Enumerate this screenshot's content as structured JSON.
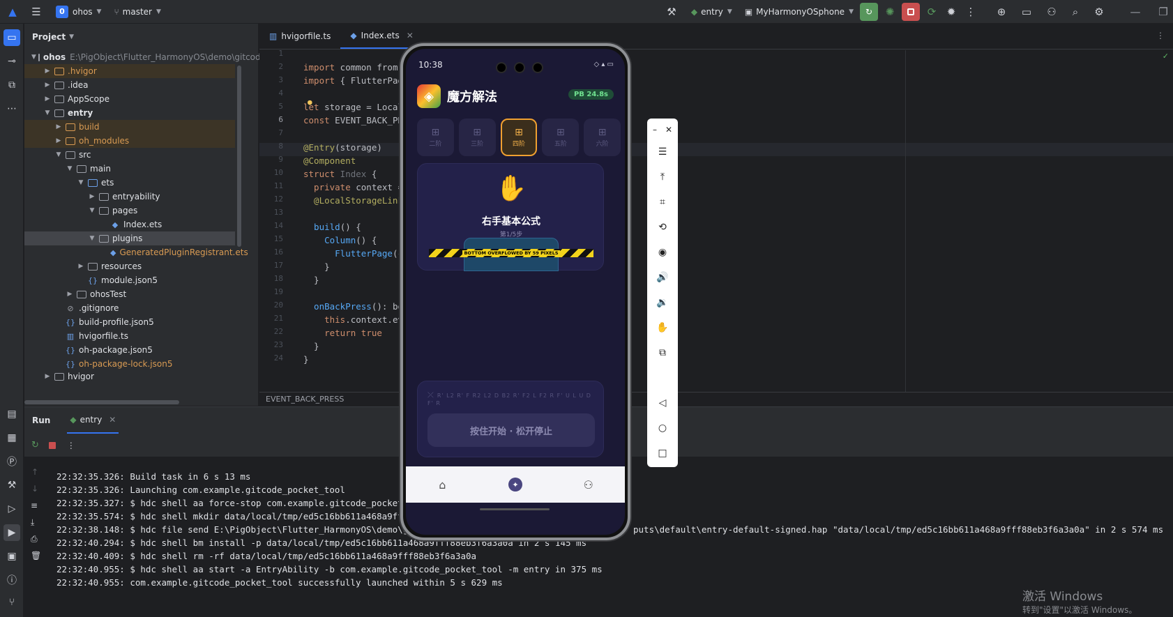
{
  "titlebar": {
    "project_badge": "0",
    "project_name": "ohos",
    "branch": "master",
    "run_config": "entry",
    "device": "MyHarmonyOSphone"
  },
  "project_panel": {
    "title": "Project",
    "root_name": "ohos",
    "root_path": "E:\\PigObject\\Flutter_HarmonyOS\\demo\\gitcode_",
    "items": [
      {
        "label": ".hvigor"
      },
      {
        "label": ".idea"
      },
      {
        "label": "AppScope"
      },
      {
        "label": "entry"
      },
      {
        "label": "build"
      },
      {
        "label": "oh_modules"
      },
      {
        "label": "src"
      },
      {
        "label": "main"
      },
      {
        "label": "ets"
      },
      {
        "label": "entryability"
      },
      {
        "label": "pages"
      },
      {
        "label": "Index.ets"
      },
      {
        "label": "plugins"
      },
      {
        "label": "GeneratedPluginRegistrant.ets"
      },
      {
        "label": "resources"
      },
      {
        "label": "module.json5"
      },
      {
        "label": "ohosTest"
      },
      {
        "label": ".gitignore"
      },
      {
        "label": "build-profile.json5"
      },
      {
        "label": "hvigorfile.ts"
      },
      {
        "label": "oh-package.json5"
      },
      {
        "label": "oh-package-lock.json5"
      },
      {
        "label": "hvigor"
      }
    ]
  },
  "editor": {
    "tabs": [
      {
        "label": "hvigorfile.ts"
      },
      {
        "label": "Index.ets"
      }
    ],
    "line_numbers": [
      "1",
      "2",
      "3",
      "4",
      "5",
      "6",
      "7",
      "8",
      "9",
      "10",
      "11",
      "12",
      "13",
      "14",
      "15",
      "16",
      "17",
      "18",
      "19",
      "20",
      "21",
      "22",
      "23",
      "24"
    ],
    "breadcrumb": "EVENT_BACK_PRESS",
    "code": {
      "l2a": "import",
      "l2b": " common from",
      "l3a": "import",
      "l3b": " { FlutterPag",
      "l5a": "let",
      "l5b": " storage = Local",
      "l6a": "const",
      "l6b": " EVENT_BACK_PR",
      "l8a": "@Entry",
      "l8b": "(storage)",
      "l9a": "@Component",
      "l10a": "struct",
      "l10b": " Index",
      "l10c": " {",
      "l11a": "  private",
      "l11b": " context =",
      "l12a": "  @LocalStorageLink",
      "l14a": "  build",
      "l14b": "() {",
      "l15a": "    Column",
      "l15b": "() {",
      "l16a": "      FlutterPage",
      "l16b": "({",
      "l17a": "    }",
      "l18a": "  }",
      "l20a": "  onBackPress",
      "l20b": "(): bo",
      "l21a": "    this",
      "l21b": ".context.ev",
      "l22a": "    return",
      "l22b": " true",
      "l23a": "  }",
      "l24a": "}"
    }
  },
  "run_panel": {
    "title": "Run",
    "tab": "entry",
    "log": [
      "22:32:35.326: Build task in 6 s 13 ms",
      "22:32:35.326: Launching com.example.gitcode_pocket_tool",
      "22:32:35.327: $ hdc shell aa force-stop com.example.gitcode_pocket_t",
      "22:32:35.574: $ hdc shell mkdir data/local/tmp/ed5c16bb611a468a9fff8",
      "22:32:38.148: $ hdc file send E:\\PigObject\\Flutter_HarmonyOS\\demo\\gitc",
      "22:32:40.294: $ hdc shell bm install -p data/local/tmp/ed5c16bb611a468a9fff88eb3f6a3a0a in 2 s 145 ms",
      "22:32:40.409: $ hdc shell rm -rf data/local/tmp/ed5c16bb611a468a9fff88eb3f6a3a0a",
      "22:32:40.955: $ hdc shell aa start -a EntryAbility -b com.example.gitcode_pocket_tool -m entry in 375 ms",
      "22:32:40.955: com.example.gitcode_pocket_tool successfully launched within 5 s 629 ms"
    ],
    "log_tail_4": "puts\\default\\entry-default-signed.hap \"data/local/tmp/ed5c16bb611a468a9fff88eb3f6a3a0a\" in 2 s 574 ms"
  },
  "phone": {
    "time": "10:38",
    "app_title": "魔方解法",
    "pb_badge": "PB 24.8s",
    "levels": [
      {
        "label": "二阶",
        "active": false
      },
      {
        "label": "三阶",
        "active": false
      },
      {
        "label": "四阶",
        "active": true
      },
      {
        "label": "五阶",
        "active": false
      },
      {
        "label": "六阶",
        "active": false
      }
    ],
    "formula_icon": "hand-icon",
    "formula_title": "右手基本公式",
    "formula_step": "第1/5步",
    "overflow_text": "BOTTOM OVERFLOWED BY 59 PIXELS",
    "scramble": "R' L2 R' F R2 L2 D B2 R' F2 L F2 R F' U L U D F' R",
    "hold_button": "按住开始 · 松开停止",
    "accent_color": "#f0a030"
  },
  "watermark": {
    "line1": "激活 Windows",
    "line2": "转到\"设置\"以激活 Windows。"
  }
}
